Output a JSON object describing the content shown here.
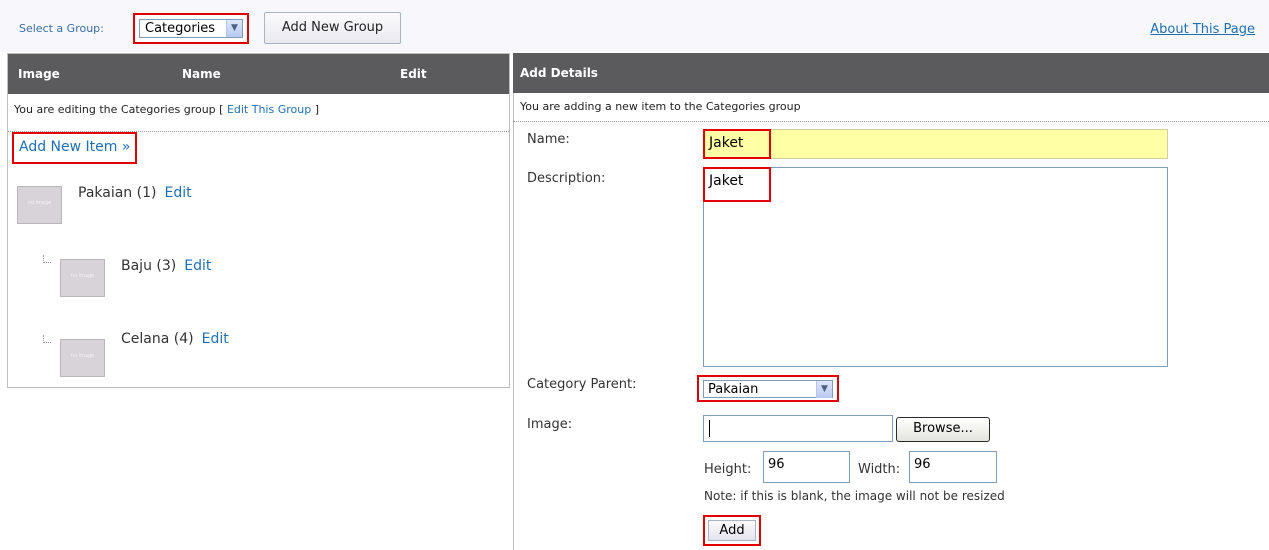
{
  "topbar": {
    "select_label": "Select a Group:",
    "group_value": "Categories",
    "add_group_label": "Add New Group",
    "about_link": "About This Page"
  },
  "left_panel": {
    "columns": [
      "Image",
      "Name",
      "Edit"
    ],
    "info_prefix": "You are editing the Categories group [ ",
    "info_link": "Edit This Group",
    "info_suffix": " ]",
    "add_item_link": "Add New Item »",
    "thumb_text": "no image",
    "items": [
      {
        "label": "Pakaian (1)",
        "edit": "Edit",
        "level": 0
      },
      {
        "label": "Baju (3)",
        "edit": "Edit",
        "level": 1
      },
      {
        "label": "Celana (4)",
        "edit": "Edit",
        "level": 1
      }
    ]
  },
  "right_panel": {
    "header": "Add Details",
    "info": "You are adding a new item to the Categories group",
    "name_label": "Name:",
    "name_value": "Jaket",
    "description_label": "Description:",
    "description_value": "Jaket",
    "parent_label": "Category Parent:",
    "parent_value": "Pakaian",
    "image_label": "Image:",
    "browse_label": "Browse...",
    "height_label": "Height:",
    "height_value": "96",
    "width_label": "Width:",
    "width_value": "96",
    "note": "Note: if this is blank, the image will not be resized",
    "add_label": "Add"
  },
  "colors": {
    "header_bg": "#5b5a5c",
    "link": "#1f6fb5",
    "highlight": "#e00000",
    "name_field_bg": "#ffffa6"
  }
}
